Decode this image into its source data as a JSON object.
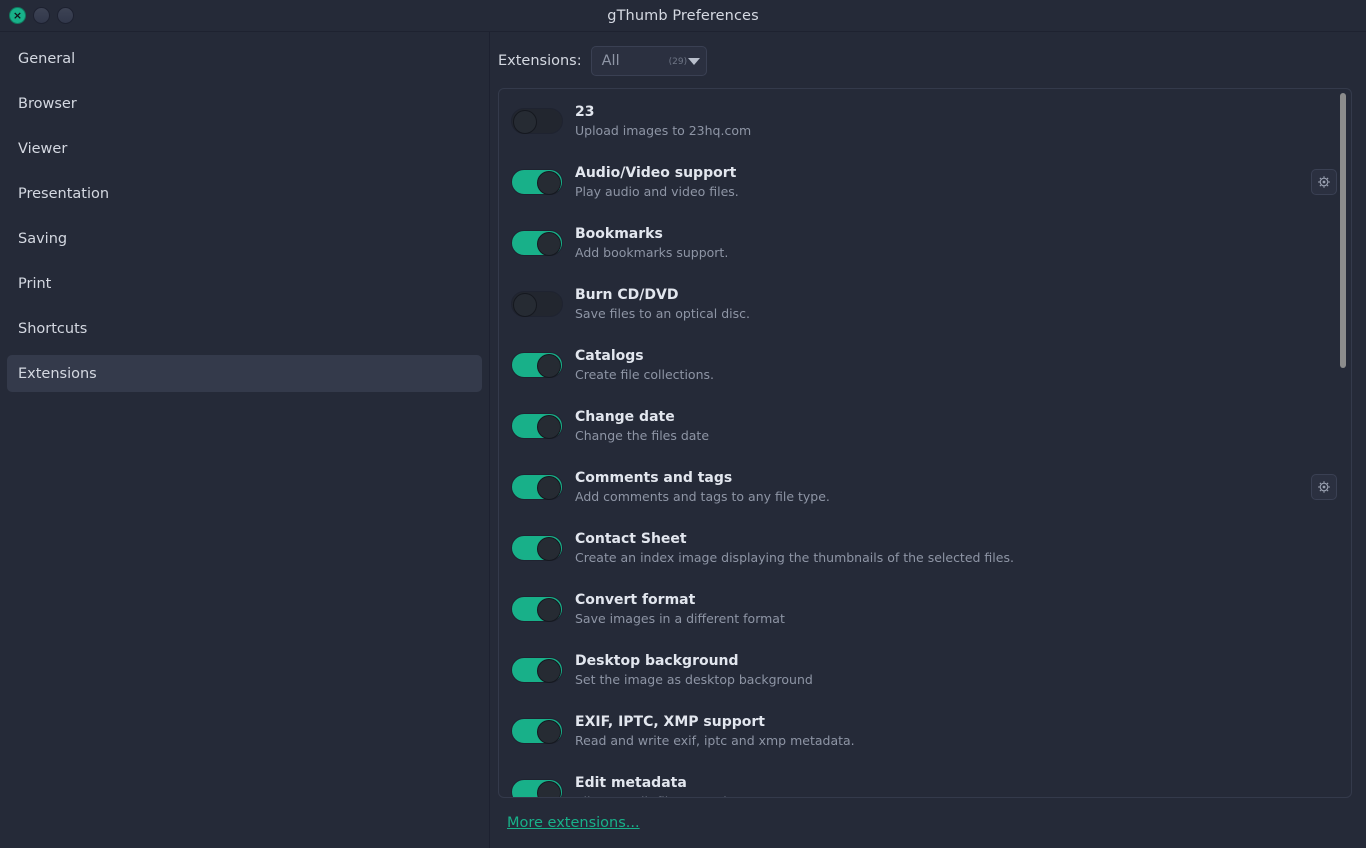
{
  "window": {
    "title": "gThumb Preferences",
    "controls": {
      "close_glyph": "×",
      "close_name": "close",
      "minimize_name": "minimize",
      "maximize_name": "maximize"
    },
    "accent_color": "#18b089",
    "background_color": "#252a38"
  },
  "sidebar": {
    "items": [
      {
        "label": "General",
        "selected": false
      },
      {
        "label": "Browser",
        "selected": false
      },
      {
        "label": "Viewer",
        "selected": false
      },
      {
        "label": "Presentation",
        "selected": false
      },
      {
        "label": "Saving",
        "selected": false
      },
      {
        "label": "Print",
        "selected": false
      },
      {
        "label": "Shortcuts",
        "selected": false
      },
      {
        "label": "Extensions",
        "selected": true
      }
    ]
  },
  "filter": {
    "label": "Extensions:",
    "selected_value": "All",
    "count_text": "(29)",
    "options": [
      "All"
    ],
    "arrow_icon": "chevron-down-icon"
  },
  "extensions": {
    "gear_icon": "gear-icon",
    "items": [
      {
        "name": "23",
        "description": "Upload images to 23hq.com",
        "enabled": false,
        "has_settings": false
      },
      {
        "name": "Audio/Video support",
        "description": "Play audio and video files.",
        "enabled": true,
        "has_settings": true
      },
      {
        "name": "Bookmarks",
        "description": "Add bookmarks support.",
        "enabled": true,
        "has_settings": false
      },
      {
        "name": "Burn CD/DVD",
        "description": "Save files to an optical disc.",
        "enabled": false,
        "has_settings": false
      },
      {
        "name": "Catalogs",
        "description": "Create file collections.",
        "enabled": true,
        "has_settings": false
      },
      {
        "name": "Change date",
        "description": "Change the files date",
        "enabled": true,
        "has_settings": false
      },
      {
        "name": "Comments and tags",
        "description": "Add comments and tags to any file type.",
        "enabled": true,
        "has_settings": true
      },
      {
        "name": "Contact Sheet",
        "description": "Create an index image displaying the thumbnails of the selected files.",
        "enabled": true,
        "has_settings": false
      },
      {
        "name": "Convert format",
        "description": "Save images in a different format",
        "enabled": true,
        "has_settings": false
      },
      {
        "name": "Desktop background",
        "description": "Set the image as desktop background",
        "enabled": true,
        "has_settings": false
      },
      {
        "name": "EXIF, IPTC, XMP support",
        "description": "Read and write exif, iptc and xmp metadata.",
        "enabled": true,
        "has_settings": false
      },
      {
        "name": "Edit metadata",
        "description": "Allow to edit files metadata.",
        "enabled": true,
        "has_settings": false
      }
    ]
  },
  "footer": {
    "more_extensions_label": "More extensions..."
  }
}
